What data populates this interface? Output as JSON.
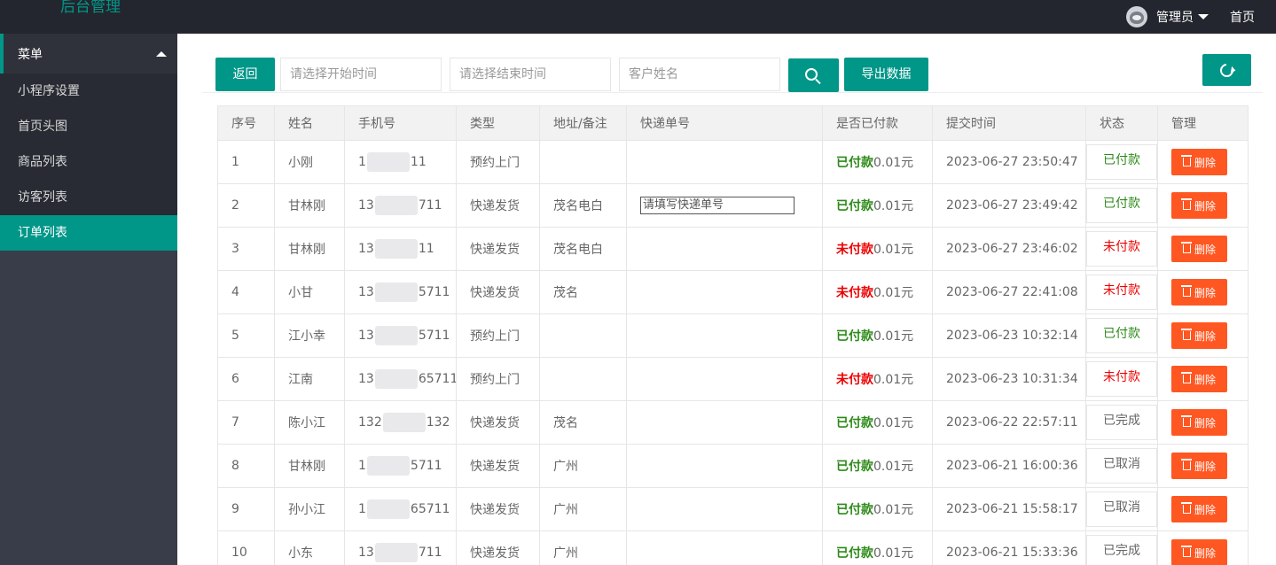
{
  "header": {
    "brand": "后台管理",
    "user": "管理员",
    "home": "首页"
  },
  "sidebar": {
    "menu_title": "菜单",
    "items": [
      {
        "label": "小程序设置"
      },
      {
        "label": "首页头图"
      },
      {
        "label": "商品列表"
      },
      {
        "label": "访客列表"
      },
      {
        "label": "订单列表",
        "active": true
      }
    ]
  },
  "toolbar": {
    "back_label": "返回",
    "start_placeholder": "请选择开始时间",
    "end_placeholder": "请选择结束时间",
    "name_placeholder": "客户姓名",
    "export_label": "导出数据"
  },
  "table": {
    "columns": [
      "序号",
      "姓名",
      "手机号",
      "类型",
      "地址/备注",
      "快递单号",
      "是否已付款",
      "提交时间",
      "状态",
      "管理"
    ],
    "delete_label": "删除",
    "express_placeholder": "请填写快递单号",
    "rows": [
      {
        "no": "1",
        "name": "小刚",
        "phone_pre": "1",
        "phone_suf": "11",
        "type": "预约上门",
        "addr": "",
        "express": "",
        "pay": "已付款",
        "paid": true,
        "amount": "0.01元",
        "time": "2023-06-27 23:50:47",
        "status": "已付款",
        "status_kind": "paid"
      },
      {
        "no": "2",
        "name": "甘林刚",
        "phone_pre": "13",
        "phone_suf": "711",
        "type": "快递发货",
        "addr": "茂名电白",
        "express": "input",
        "pay": "已付款",
        "paid": true,
        "amount": "0.01元",
        "time": "2023-06-27 23:49:42",
        "status": "已付款",
        "status_kind": "paid"
      },
      {
        "no": "3",
        "name": "甘林刚",
        "phone_pre": "13",
        "phone_suf": "11",
        "type": "快递发货",
        "addr": "茂名电白",
        "express": "",
        "pay": "未付款",
        "paid": false,
        "amount": "0.01元",
        "time": "2023-06-27 23:46:02",
        "status": "未付款",
        "status_kind": "unpaid"
      },
      {
        "no": "4",
        "name": "小甘",
        "phone_pre": "13",
        "phone_suf": "5711",
        "type": "快递发货",
        "addr": "茂名",
        "express": "",
        "pay": "未付款",
        "paid": false,
        "amount": "0.01元",
        "time": "2023-06-27 22:41:08",
        "status": "未付款",
        "status_kind": "unpaid"
      },
      {
        "no": "5",
        "name": "江小幸",
        "phone_pre": "13",
        "phone_suf": "5711",
        "type": "预约上门",
        "addr": "",
        "express": "",
        "pay": "已付款",
        "paid": true,
        "amount": "0.01元",
        "time": "2023-06-23 10:32:14",
        "status": "已付款",
        "status_kind": "paid"
      },
      {
        "no": "6",
        "name": "江南",
        "phone_pre": "13",
        "phone_suf": "65711",
        "type": "预约上门",
        "addr": "",
        "express": "",
        "pay": "未付款",
        "paid": false,
        "amount": "0.01元",
        "time": "2023-06-23 10:31:34",
        "status": "未付款",
        "status_kind": "unpaid"
      },
      {
        "no": "7",
        "name": "陈小江",
        "phone_pre": "132",
        "phone_suf": "132",
        "type": "快递发货",
        "addr": "茂名",
        "express": "",
        "pay": "已付款",
        "paid": true,
        "amount": "0.01元",
        "time": "2023-06-22 22:57:11",
        "status": "已完成",
        "status_kind": "done"
      },
      {
        "no": "8",
        "name": "甘林刚",
        "phone_pre": "1",
        "phone_suf": "5711",
        "type": "快递发货",
        "addr": "广州",
        "express": "",
        "pay": "已付款",
        "paid": true,
        "amount": "0.01元",
        "time": "2023-06-21 16:00:36",
        "status": "已取消",
        "status_kind": "done"
      },
      {
        "no": "9",
        "name": "孙小江",
        "phone_pre": "1",
        "phone_suf": "65711",
        "type": "快递发货",
        "addr": "广州",
        "express": "",
        "pay": "已付款",
        "paid": true,
        "amount": "0.01元",
        "time": "2023-06-21 15:58:17",
        "status": "已取消",
        "status_kind": "done"
      },
      {
        "no": "10",
        "name": "小东",
        "phone_pre": "13",
        "phone_suf": "711",
        "type": "快递发货",
        "addr": "广州",
        "express": "",
        "pay": "已付款",
        "paid": true,
        "amount": "0.01元",
        "time": "2023-06-21 15:33:36",
        "status": "已完成",
        "status_kind": "done"
      }
    ]
  }
}
